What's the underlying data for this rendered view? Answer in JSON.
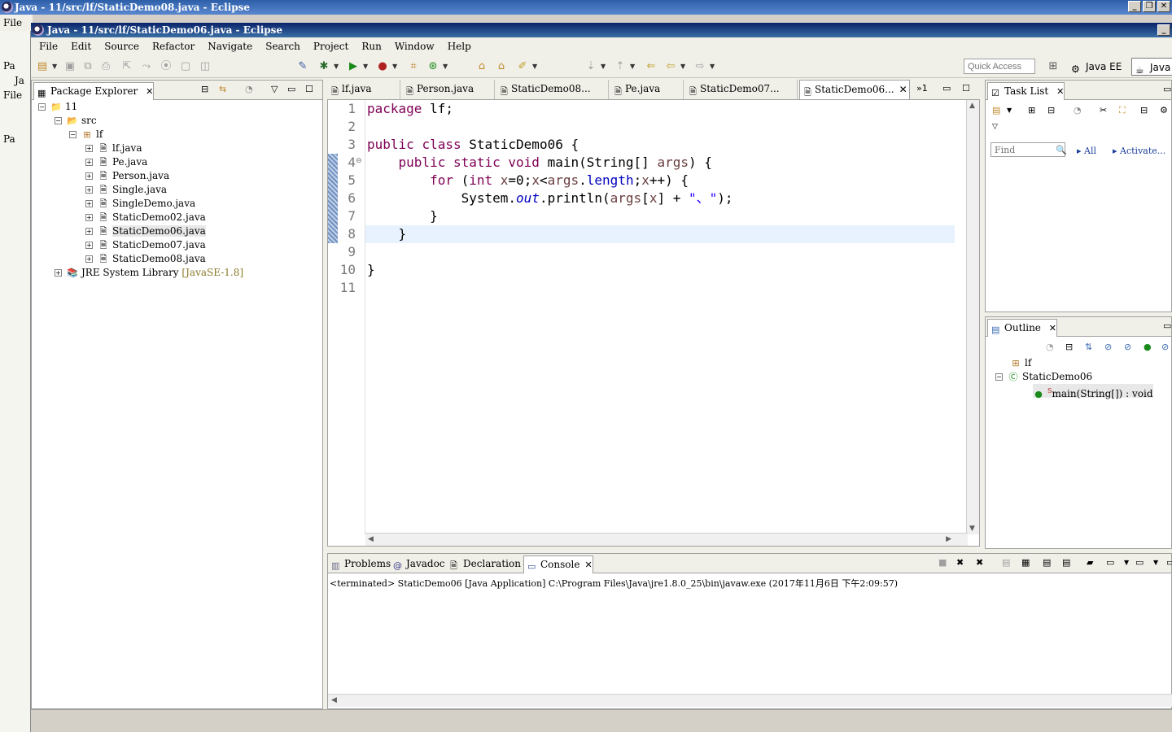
{
  "background_window": {
    "title": "Java - 11/src/lf/StaticDemo08.java - Eclipse",
    "menu_file": "File",
    "left_rows": [
      "Pa",
      "Ja",
      "File",
      "Pa"
    ]
  },
  "window": {
    "title": "Java - 11/src/lf/StaticDemo06.java - Eclipse"
  },
  "menu": [
    "File",
    "Edit",
    "Source",
    "Refactor",
    "Navigate",
    "Search",
    "Project",
    "Run",
    "Window",
    "Help"
  ],
  "toolbar": {
    "quick_access_placeholder": "Quick Access",
    "perspective_javaee": "Java EE",
    "perspective_java": "Java"
  },
  "package_explorer": {
    "tab_label": "Package Explorer",
    "tree": [
      {
        "label": "11",
        "icon": "project-icon",
        "level": 0,
        "expanded": true
      },
      {
        "label": "src",
        "icon": "source-folder-icon",
        "level": 1,
        "expanded": true
      },
      {
        "label": "lf",
        "icon": "package-icon",
        "level": 2,
        "expanded": true
      },
      {
        "label": "lf.java",
        "icon": "java-file-icon",
        "level": 3
      },
      {
        "label": "Pe.java",
        "icon": "java-file-icon",
        "level": 3
      },
      {
        "label": "Person.java",
        "icon": "java-file-icon",
        "level": 3
      },
      {
        "label": "Single.java",
        "icon": "java-file-icon",
        "level": 3
      },
      {
        "label": "SingleDemo.java",
        "icon": "java-file-icon",
        "level": 3
      },
      {
        "label": "StaticDemo02.java",
        "icon": "java-file-icon",
        "level": 3
      },
      {
        "label": "StaticDemo06.java",
        "icon": "java-file-icon",
        "level": 3,
        "selected": true
      },
      {
        "label": "StaticDemo07.java",
        "icon": "java-file-icon",
        "level": 3
      },
      {
        "label": "StaticDemo08.java",
        "icon": "java-file-icon",
        "level": 3
      }
    ],
    "jre": {
      "label": "JRE System Library",
      "decoration": "[JavaSE-1.8]"
    }
  },
  "editor": {
    "tabs": [
      "lf.java",
      "Person.java",
      "StaticDemo08...",
      "Pe.java",
      "StaticDemo07...",
      "StaticDemo06..."
    ],
    "overflow_label": "»1",
    "line_numbers": [
      "1",
      "2",
      "3",
      "4",
      "5",
      "6",
      "7",
      "8",
      "9",
      "10",
      "11"
    ],
    "current_line": 8,
    "code": {
      "l1_kw": "package",
      "l1_rest": " lf;",
      "l3_kw1": "public",
      "l3_kw2": "class",
      "l3_rest": " StaticDemo06 {",
      "l4_indent": "    ",
      "l4_kw1": "public",
      "l4_kw2": "static",
      "l4_kw3": "void",
      "l4_a": " main(String[] ",
      "l4_var": "args",
      "l4_b": ") {",
      "l5_indent": "        ",
      "l5_kw": "for",
      "l5_a": " (",
      "l5_kw2": "int",
      "l5_sp": " ",
      "l5_x1": "x",
      "l5_b": "=0;",
      "l5_x2": "x",
      "l5_c": "<",
      "l5_args": "args",
      "l5_d": ".",
      "l5_len": "length",
      "l5_e": ";",
      "l5_x3": "x",
      "l5_f": "++) {",
      "l6_indent": "            ",
      "l6_a": "System.",
      "l6_out": "out",
      "l6_b": ".println(",
      "l6_args": "args",
      "l6_c": "[",
      "l6_x": "x",
      "l6_d": "] + ",
      "l6_str": "\"、\"",
      "l6_e": ");",
      "l7": "        }",
      "l8": "    }",
      "l10": "}"
    }
  },
  "bottom_panel": {
    "tabs": [
      "Problems",
      "Javadoc",
      "Declaration",
      "Console"
    ],
    "console_text": "<terminated> StaticDemo06 [Java Application] C:\\Program Files\\Java\\jre1.8.0_25\\bin\\javaw.exe (2017年11月6日 下午2:09:57)"
  },
  "task_list": {
    "tab_label": "Task List",
    "find_placeholder": "Find",
    "all_label": "All",
    "activate_label": "Activate..."
  },
  "outline": {
    "tab_label": "Outline",
    "items": [
      {
        "label": "lf",
        "icon": "package-icon"
      },
      {
        "label": "StaticDemo06",
        "icon": "class-icon"
      },
      {
        "label": "main(String[]) : void",
        "icon": "method-icon",
        "modifier": "S"
      }
    ]
  }
}
